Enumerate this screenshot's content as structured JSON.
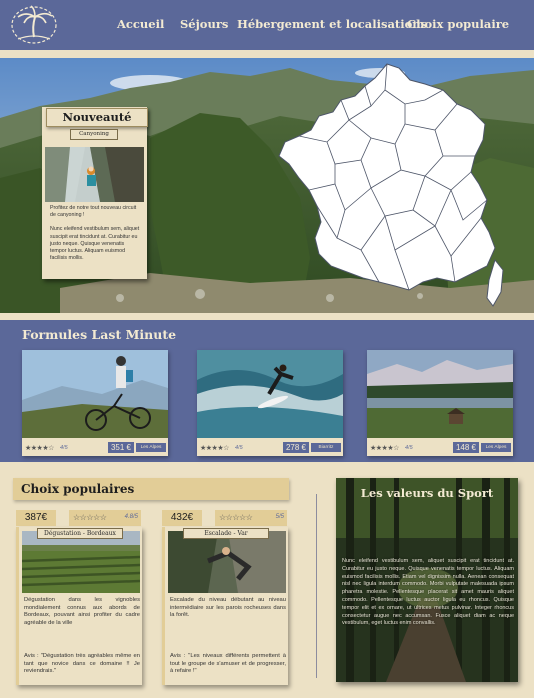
{
  "nav": {
    "items": [
      "Accueil",
      "Séjours",
      "Hébergement et localisations",
      "Choix populaire"
    ],
    "colors": {
      "bar": "#5b6899",
      "text": "#f3ead2",
      "cream": "#ece1c5"
    },
    "logo_icon": "palm-tree-logo"
  },
  "hero": {
    "map_icon": "france-regions-map",
    "new_card": {
      "title": "Nouveauté",
      "tag": "Canyoning",
      "text1": "Profitez de notre tout nouveau circuit de canyoning !",
      "text2": "Nunc eleifend vestibulum sem, aliquet suscipit erat tincidunt at. Curabitur eu justo neque. Quisque venenatis tempor luctus. Aliquam euismod facilisis mollis."
    }
  },
  "last_minute": {
    "title": "Formules Last Minute",
    "cards": [
      {
        "image": "mountain-biker-photo",
        "stars": "★★★★☆",
        "rating": "4/5",
        "price": "351 €",
        "place": "Les Alpes"
      },
      {
        "image": "surfer-photo",
        "stars": "★★★★☆",
        "rating": "4/5",
        "price": "278 €",
        "place": "Biarritz"
      },
      {
        "image": "alpine-lake-photo",
        "stars": "★★★★☆",
        "rating": "4/5",
        "price": "148 €",
        "place": "Les Alpes"
      }
    ]
  },
  "popular": {
    "title": "Choix populaires",
    "cards": [
      {
        "price": "387€",
        "stars": "☆☆☆☆☆",
        "rating": "4.8/5",
        "tag": "Dégustation - Bordeaux",
        "text": "Dégustation dans les vignobles mondialement connus aux abords de Bordeaux, pouvant ainsi profiter du cadre agréable de la ville",
        "quote": "Avis : \"Dégustation très agréables même en tant que novice dans ce domaine !! Je reviendrais.\""
      },
      {
        "price": "432€",
        "stars": "☆☆☆☆☆",
        "rating": "5/5",
        "tag": "Escalade - Var",
        "text": "Escalade du niveau débutant au niveau intermédiaire sur les parois rocheuses dans la forêt.",
        "quote": "Avis : \"Les niveaux différents permettent à tout le groupe de s'amuser et de progresser, à refaire !\""
      }
    ]
  },
  "values": {
    "title": "Les valeurs du Sport",
    "text": "Nunc eleifend vestibulum sem, aliquet suscipit erat tincidunt at. Curabitur eu justo neque. Quisque venenatis tempor luctus. Aliquam euismod facilisis mollis. Etiam vel dignissim nulla. Aenean consequat nisl nec ligula interdum commodo. Morbi vulputate malesuada ipsum pharetra molestie. Pellentesque placerat sit amet mauris aliquet commodo. Pellentesque luctus auctor ligula eu rhoncus. Quisque tempor elit et ex ornare, ut ultrices metus pulvinar. Integer rhoncus consectetur augue nec accumsan. Fusce aliquet diam ac neque vestibulum, eget luctus enim convallis."
  }
}
